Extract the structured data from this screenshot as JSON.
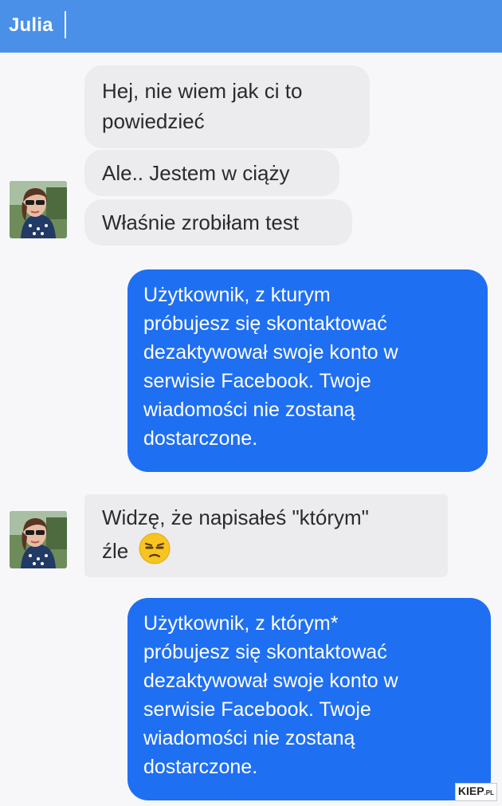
{
  "header": {
    "contact_name": "Julia"
  },
  "messages": {
    "m1_l1": "Hej, nie wiem jak ci to",
    "m1_l2": "powiedzieć",
    "m2": "Ale.. Jestem w ciąży",
    "m3": "Właśnie zrobiłam test",
    "m4_l1": "Użytkownik, z kturym",
    "m4_l2": "próbujesz się skontaktować",
    "m4_l3": "dezaktywował swoje konto w",
    "m4_l4": "serwisie Facebook. Twoje",
    "m4_l5": "wiadomości nie zostaną",
    "m4_l6": "dostarczone.",
    "m5_l1": "Widzę, że napisałeś \"którym\"",
    "m5_l2": "źle",
    "m6_l1": "Użytkownik, z którym*",
    "m6_l2": "próbujesz się skontaktować",
    "m6_l3": "dezaktywował swoje konto w",
    "m6_l4": "serwisie Facebook. Twoje",
    "m6_l5": "wiadomości nie zostaną",
    "m6_l6": "dostarczone."
  },
  "icons": {
    "emoji": "unamused-face-icon",
    "avatar": "contact-avatar"
  },
  "watermark": {
    "main": "KIEP",
    "suffix": ".PL"
  },
  "colors": {
    "header_bg": "#4a90e9",
    "outgoing_bubble": "#1f6ff2",
    "incoming_bubble": "#ececef",
    "chat_bg": "#f7f7f9"
  }
}
